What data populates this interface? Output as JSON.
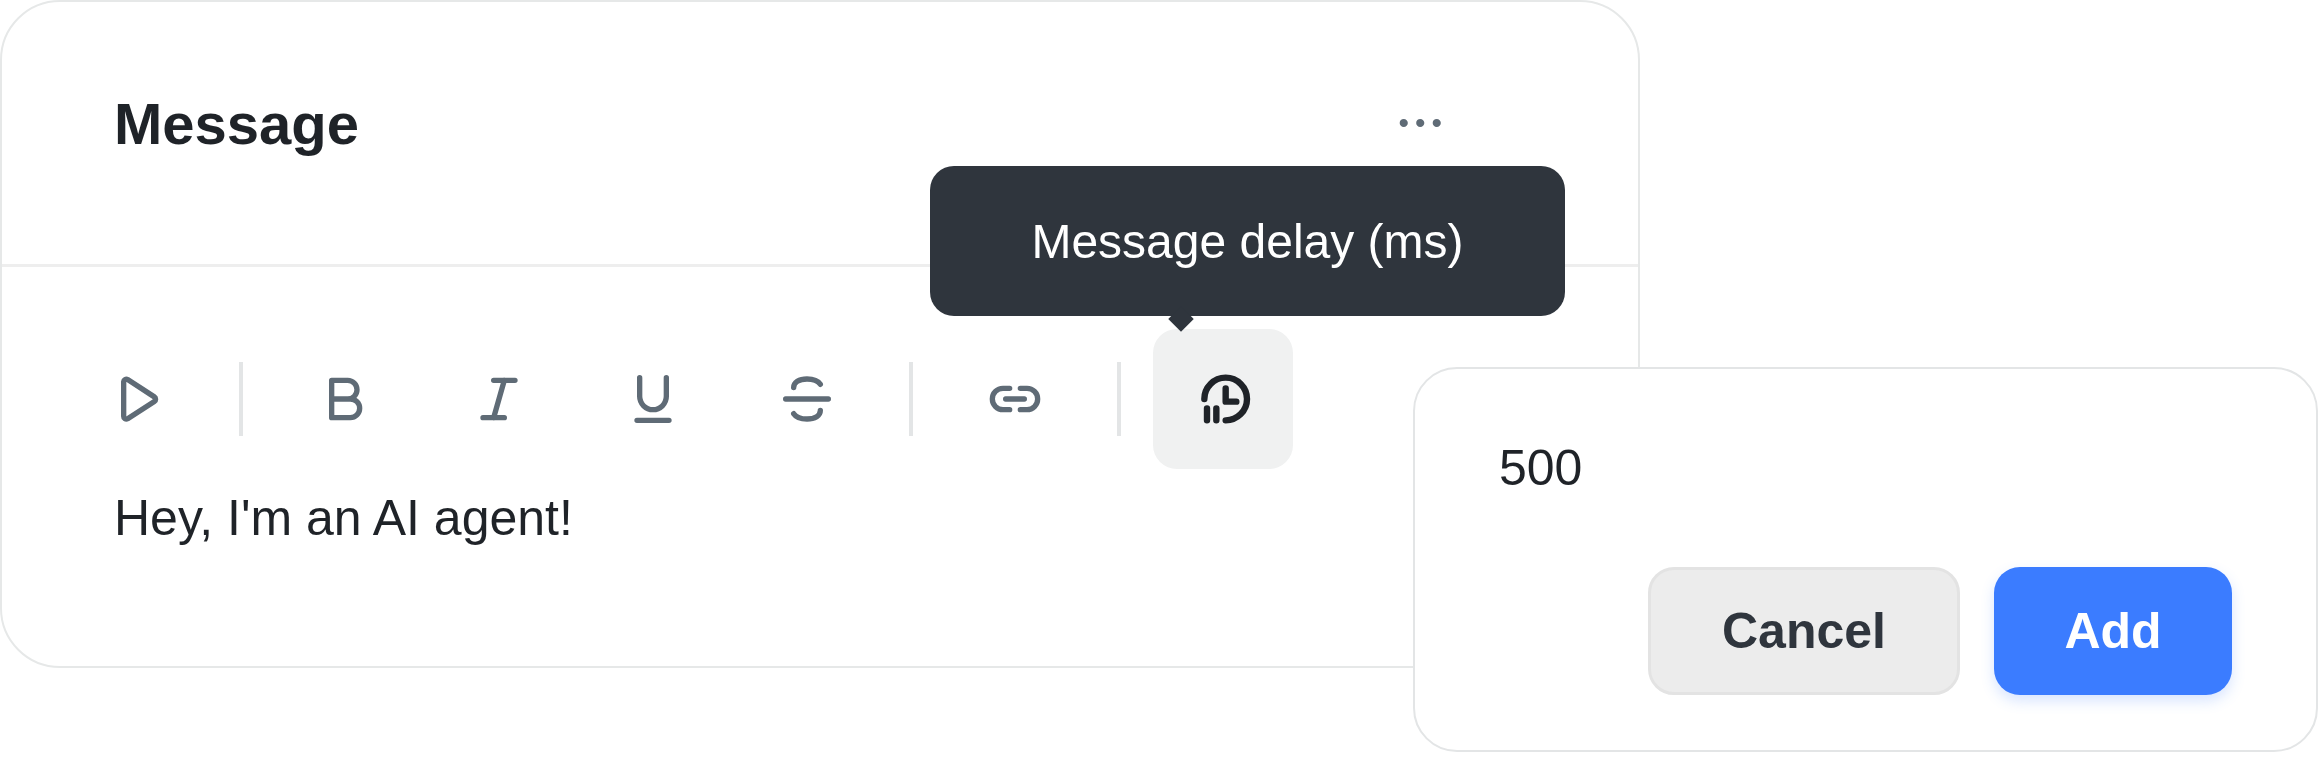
{
  "card": {
    "title": "Message",
    "more_label": "•••",
    "tooltip": "Message delay (ms)",
    "toolbar": [
      {
        "kind": "play",
        "selected": false
      },
      {
        "kind": "divider"
      },
      {
        "kind": "bold",
        "selected": false
      },
      {
        "kind": "italic",
        "selected": false
      },
      {
        "kind": "underline",
        "selected": false
      },
      {
        "kind": "strike",
        "selected": false
      },
      {
        "kind": "divider"
      },
      {
        "kind": "link",
        "selected": false
      },
      {
        "kind": "divider"
      },
      {
        "kind": "delay",
        "selected": true
      }
    ],
    "body": "Hey, I'm an AI agent!"
  },
  "popover": {
    "value": "500",
    "buttons": [
      {
        "label": "Cancel",
        "kind": "secondary"
      },
      {
        "label": "Add",
        "kind": "primary"
      }
    ]
  }
}
